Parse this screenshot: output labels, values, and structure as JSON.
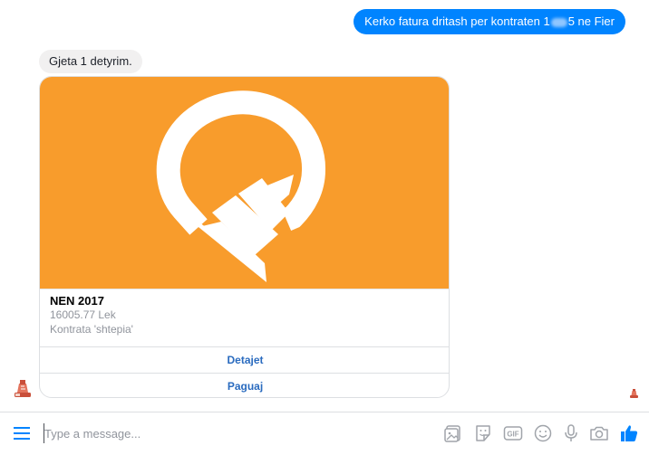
{
  "conversation": {
    "outgoing_message": {
      "prefix": "Kerko fatura dritash per kontraten 1",
      "suffix": "5 ne Fier"
    },
    "incoming_message": "Gjeta 1 detyrim.",
    "card": {
      "title": "NEN 2017",
      "amount": "16005.77 Lek",
      "contract": "Kontrata 'shtepia'",
      "buttons": [
        "Detajet",
        "Paguaj"
      ],
      "image_color": "#f89c2c"
    }
  },
  "composer": {
    "placeholder": "Type a message...",
    "icons": [
      "menu-icon",
      "sticker-photo-icon",
      "sticker-icon",
      "gif-icon",
      "emoji-icon",
      "microphone-icon",
      "camera-icon",
      "thumbs-up-icon"
    ],
    "gif_label": "GIF"
  },
  "colors": {
    "outgoing_bubble": "#0084ff",
    "incoming_bubble": "#f1f0f0",
    "link": "#2a6bbf",
    "like": "#0084ff"
  }
}
